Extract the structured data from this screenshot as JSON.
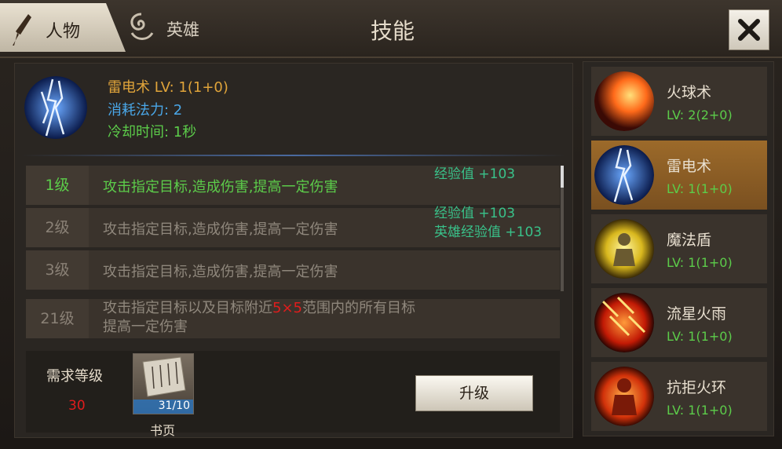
{
  "header": {
    "tab_character": "人物",
    "tab_hero": "英雄",
    "title": "技能"
  },
  "detail": {
    "name_level": "雷电术 LV: 1(1+0)",
    "mana_cost": "消耗法力: 2",
    "cooldown": "冷却时间: 1秒",
    "levels": [
      {
        "level": "1级",
        "desc": "攻击指定目标,造成伤害,提高一定伤害",
        "active": true
      },
      {
        "level": "2级",
        "desc": "攻击指定目标,造成伤害,提高一定伤害",
        "active": false
      },
      {
        "level": "3级",
        "desc": "攻击指定目标,造成伤害,提高一定伤害",
        "active": false
      }
    ],
    "level21": {
      "level": "21级",
      "desc_pre": "攻击指定目标以及目标附近",
      "desc_highlight": "5×5",
      "desc_post": "范围内的所有目标",
      "desc_line2": "提高一定伤害"
    },
    "exp_lines": [
      "经验值 +103",
      "经验值 +103",
      "英雄经验值 +103"
    ],
    "requirement_label": "需求等级",
    "requirement_value": "30",
    "book_count": "31/10",
    "book_label": "书页",
    "upgrade_label": "升级"
  },
  "skills": [
    {
      "name": "火球术",
      "level": "LV: 2(2+0)",
      "icon": "fireball-icon"
    },
    {
      "name": "雷电术",
      "level": "LV: 1(1+0)",
      "icon": "lightning-icon"
    },
    {
      "name": "魔法盾",
      "level": "LV: 1(1+0)",
      "icon": "magic-shield-icon"
    },
    {
      "name": "流星火雨",
      "level": "LV: 1(1+0)",
      "icon": "meteor-shower-icon"
    },
    {
      "name": "抗拒火环",
      "level": "LV: 1(1+0)",
      "icon": "repel-fire-ring-icon"
    }
  ],
  "colors": {
    "active_green": "#5ccc4a",
    "mana_blue": "#4aa7e8",
    "name_orange": "#e0a43a",
    "selected_bg": "#9c6a2a",
    "exp_teal": "#39c28a"
  }
}
